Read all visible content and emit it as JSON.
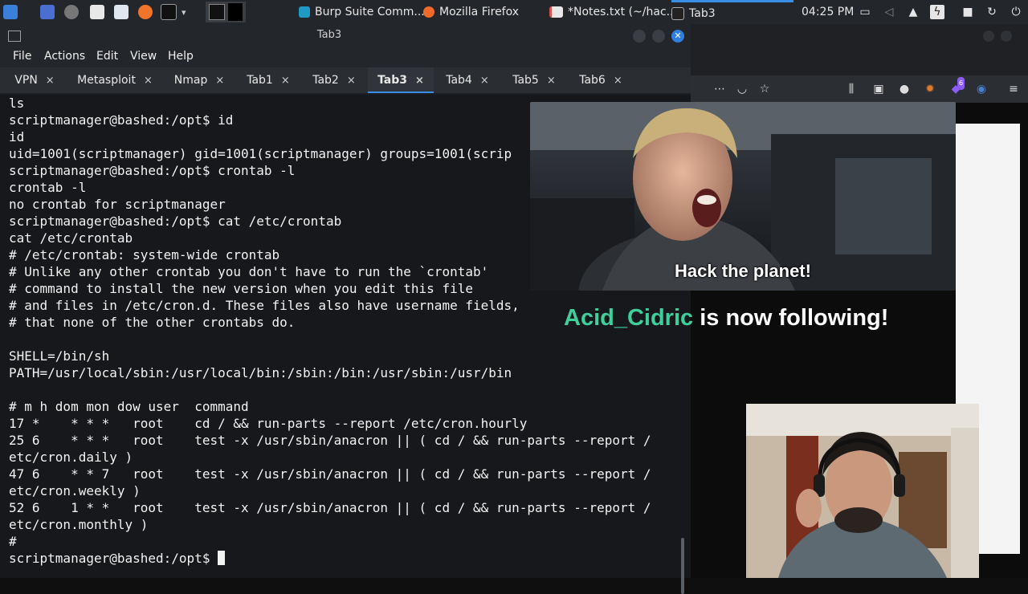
{
  "panel": {
    "tasks": [
      {
        "label": "Burp Suite Comm...",
        "icon": "burp-icon",
        "color": "#e07a2e"
      },
      {
        "label": "Mozilla Firefox",
        "icon": "firefox-icon",
        "color": "#f06a2a"
      },
      {
        "label": "*Notes.txt (~/hac...",
        "icon": "notes-icon",
        "color": "#d9534f"
      },
      {
        "label": "Tab3",
        "icon": "terminal-icon",
        "color": "#3c3c3c"
      }
    ],
    "clock": "04:25 PM"
  },
  "terminal": {
    "window_title": "Tab3",
    "menu": [
      "File",
      "Actions",
      "Edit",
      "View",
      "Help"
    ],
    "tabs": [
      {
        "label": "VPN",
        "close": "×"
      },
      {
        "label": "Metasploit",
        "close": "×"
      },
      {
        "label": "Nmap",
        "close": "×"
      },
      {
        "label": "Tab1",
        "close": "×"
      },
      {
        "label": "Tab2",
        "close": "×"
      },
      {
        "label": "Tab3",
        "close": "×"
      },
      {
        "label": "Tab4",
        "close": "×"
      },
      {
        "label": "Tab5",
        "close": "×"
      },
      {
        "label": "Tab6",
        "close": "×"
      }
    ],
    "active_tab": "Tab3",
    "lines": [
      "ls",
      "scriptmanager@bashed:/opt$ id",
      "id",
      "uid=1001(scriptmanager) gid=1001(scriptmanager) groups=1001(scrip",
      "scriptmanager@bashed:/opt$ crontab -l",
      "crontab -l",
      "no crontab for scriptmanager",
      "scriptmanager@bashed:/opt$ cat /etc/crontab",
      "cat /etc/crontab",
      "# /etc/crontab: system-wide crontab",
      "# Unlike any other crontab you don't have to run the `crontab'",
      "# command to install the new version when you edit this file",
      "# and files in /etc/cron.d. These files also have username fields,",
      "# that none of the other crontabs do.",
      "",
      "SHELL=/bin/sh",
      "PATH=/usr/local/sbin:/usr/local/bin:/sbin:/bin:/usr/sbin:/usr/bin",
      "",
      "# m h dom mon dow user  command",
      "17 *    * * *   root    cd / && run-parts --report /etc/cron.hourly",
      "25 6    * * *   root    test -x /usr/sbin/anacron || ( cd / && run-parts --report /",
      "etc/cron.daily )",
      "47 6    * * 7   root    test -x /usr/sbin/anacron || ( cd / && run-parts --report /",
      "etc/cron.weekly )",
      "52 6    1 * *   root    test -x /usr/sbin/anacron || ( cd / && run-parts --report /",
      "etc/cron.monthly )",
      "#"
    ],
    "prompt": "scriptmanager@bashed:/opt$ "
  },
  "browser": {
    "extension_badge": "6"
  },
  "overlay": {
    "meme_caption": "Hack the planet!",
    "follower_name": "Acid_Cidric",
    "follow_text": " is now following!"
  }
}
